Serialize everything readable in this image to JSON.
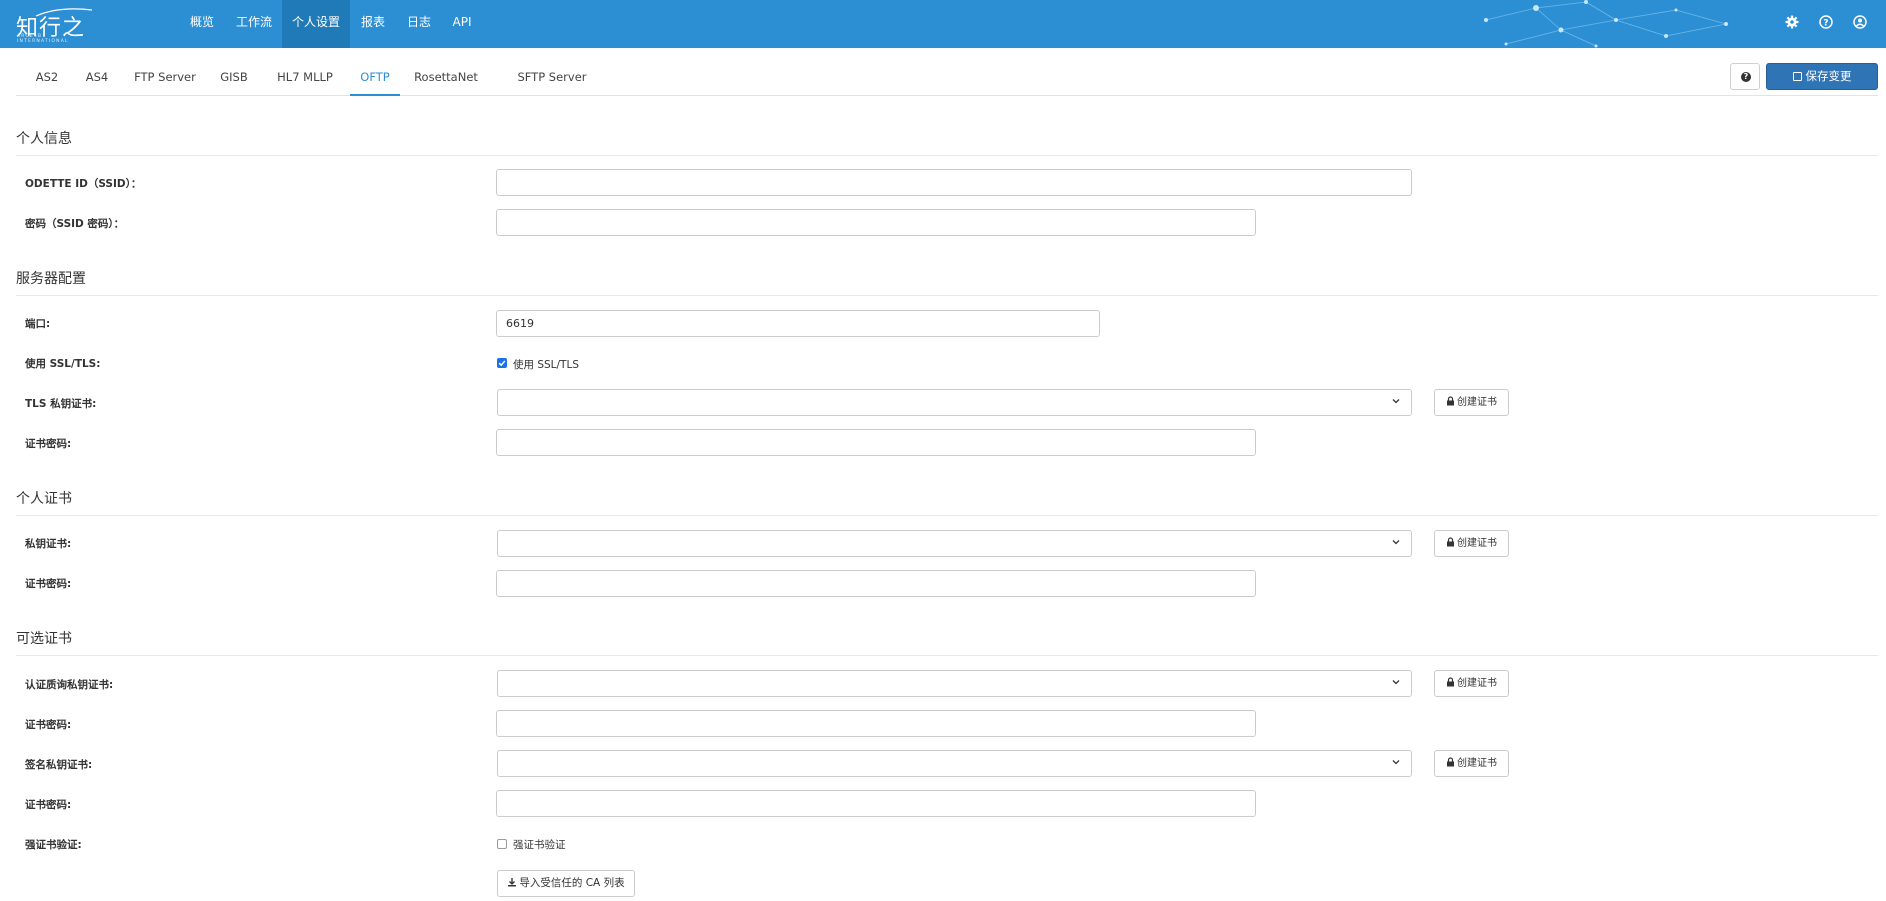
{
  "brand": {
    "name": "知行之桥",
    "subtitle": "ARCESB INTERNATIONAL"
  },
  "nav": {
    "items": [
      {
        "label": "概览"
      },
      {
        "label": "工作流"
      },
      {
        "label": "个人设置"
      },
      {
        "label": "报表"
      },
      {
        "label": "日志"
      },
      {
        "label": "API"
      }
    ],
    "active": "个人设置"
  },
  "tabs": {
    "items": [
      {
        "label": "AS2"
      },
      {
        "label": "AS4"
      },
      {
        "label": "FTP Server"
      },
      {
        "label": "GISB"
      },
      {
        "label": "HL7 MLLP"
      },
      {
        "label": "OFTP"
      },
      {
        "label": "RosettaNet"
      },
      {
        "label": "SFTP Server"
      }
    ],
    "active": "OFTP"
  },
  "toolbar": {
    "save_label": "保存变更"
  },
  "sections": {
    "personal_info": {
      "title": "个人信息",
      "odette_id_label": "ODETTE ID（SSID）：",
      "odette_id_value": "",
      "password_label": "密码（SSID 密码）：",
      "password_value": ""
    },
    "server_config": {
      "title": "服务器配置",
      "port_label": "端口:",
      "port_value": "6619",
      "ssl_label": "使用 SSL/TLS:",
      "ssl_checkbox_label": "使用 SSL/TLS",
      "ssl_checked": true,
      "tls_cert_label": "TLS 私钥证书:",
      "tls_cert_value": "",
      "cert_password_label": "证书密码:",
      "cert_password_value": ""
    },
    "personal_cert": {
      "title": "个人证书",
      "private_cert_label": "私钥证书:",
      "private_cert_value": "",
      "cert_password_label": "证书密码:",
      "cert_password_value": ""
    },
    "optional_cert": {
      "title": "可选证书",
      "auth_cert_label": "认证质询私钥证书:",
      "auth_cert_value": "",
      "auth_password_label": "证书密码:",
      "auth_password_value": "",
      "sign_cert_label": "签名私钥证书:",
      "sign_cert_value": "",
      "sign_password_label": "证书密码:",
      "sign_password_value": "",
      "strong_verify_label": "强证书验证:",
      "strong_verify_checkbox_label": "强证书验证",
      "strong_verify_checked": false,
      "import_ca_label": "导入受信任的 CA 列表"
    }
  },
  "buttons": {
    "create_cert_label": "创建证书"
  },
  "colors": {
    "navbar": "#2d8fd3",
    "active_nav": "#217ab8",
    "accent": "#2d8fd3",
    "primary_button": "#2f74b5"
  },
  "icons": [
    "gear-icon",
    "help-icon",
    "user-icon",
    "lock-icon",
    "chevron-down-icon",
    "save-icon",
    "download-icon",
    "question-icon"
  ]
}
